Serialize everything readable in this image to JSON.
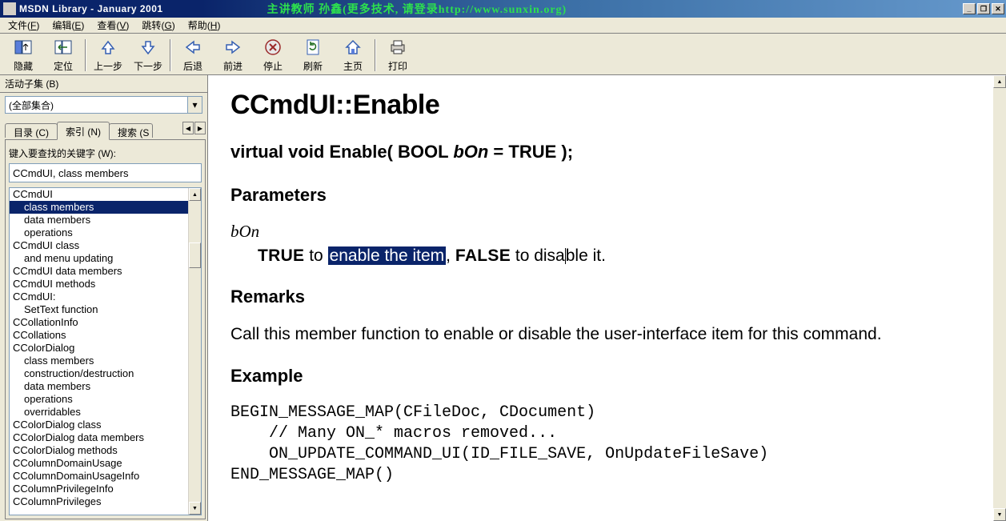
{
  "titlebar": {
    "title": "MSDN Library - January 2001",
    "banner": "主讲教师 孙鑫(更多技术, 请登录http://www.sunxin.org)"
  },
  "menubar": [
    {
      "label": "文件",
      "mn": "F"
    },
    {
      "label": "编辑",
      "mn": "E"
    },
    {
      "label": "查看",
      "mn": "V"
    },
    {
      "label": "跳转",
      "mn": "G"
    },
    {
      "label": "帮助",
      "mn": "H"
    }
  ],
  "toolbar": {
    "hide": "隐藏",
    "locate": "定位",
    "prev": "上一步",
    "next": "下一步",
    "back": "后退",
    "fwd": "前进",
    "stop": "停止",
    "refresh": "刷新",
    "home": "主页",
    "print": "打印"
  },
  "left": {
    "panel_title": "活动子集 (B)",
    "subset": "(全部集合)",
    "tabs": {
      "contents": "目录 (C)",
      "index": "索引 (N)",
      "search": "搜索 (S"
    },
    "prompt": "键入要查找的关键字 (W):",
    "keyword": "CCmdUI, class members",
    "items": [
      {
        "t": "CCmdUI",
        "d": 0
      },
      {
        "t": "class members",
        "d": 1,
        "sel": true
      },
      {
        "t": "data members",
        "d": 1
      },
      {
        "t": "operations",
        "d": 1
      },
      {
        "t": "CCmdUI class",
        "d": 0
      },
      {
        "t": "and menu updating",
        "d": 1
      },
      {
        "t": "CCmdUI data members",
        "d": 0
      },
      {
        "t": "CCmdUI methods",
        "d": 0
      },
      {
        "t": "CCmdUI:",
        "d": 0
      },
      {
        "t": "SetText function",
        "d": 1
      },
      {
        "t": "CCollationInfo",
        "d": 0
      },
      {
        "t": "CCollations",
        "d": 0
      },
      {
        "t": "CColorDialog",
        "d": 0
      },
      {
        "t": "class members",
        "d": 1
      },
      {
        "t": "construction/destruction",
        "d": 1
      },
      {
        "t": "data members",
        "d": 1
      },
      {
        "t": "operations",
        "d": 1
      },
      {
        "t": "overridables",
        "d": 1
      },
      {
        "t": "CColorDialog class",
        "d": 0
      },
      {
        "t": "CColorDialog data members",
        "d": 0
      },
      {
        "t": "CColorDialog methods",
        "d": 0
      },
      {
        "t": "CColumnDomainUsage",
        "d": 0
      },
      {
        "t": "CColumnDomainUsageInfo",
        "d": 0
      },
      {
        "t": "CColumnPrivilegeInfo",
        "d": 0
      },
      {
        "t": "CColumnPrivileges",
        "d": 0
      }
    ]
  },
  "content": {
    "h1": "CCmdUI::Enable",
    "sig_pre": "virtual void Enable( BOOL ",
    "sig_param": "bOn",
    "sig_post": " = TRUE );",
    "h_params": "Parameters",
    "param_name": "bOn",
    "p_true": "TRUE",
    "p_to": " to ",
    "p_sel": "enable the item",
    "p_comma": ", ",
    "p_false": "FALSE",
    "p_rest": " to disable it.",
    "h_remarks": "Remarks",
    "remarks": "Call this member function to enable or disable the user-interface item for this command.",
    "h_example": "Example",
    "code": "BEGIN_MESSAGE_MAP(CFileDoc, CDocument)\n    // Many ON_* macros removed...\n    ON_UPDATE_COMMAND_UI(ID_FILE_SAVE, OnUpdateFileSave)\nEND_MESSAGE_MAP()"
  }
}
